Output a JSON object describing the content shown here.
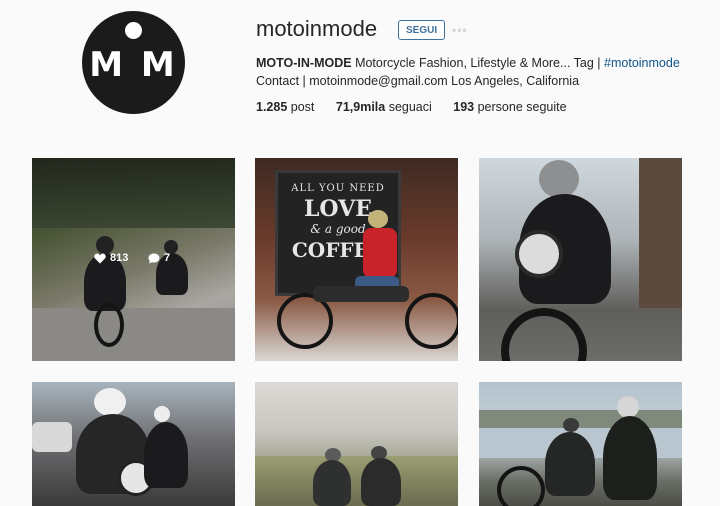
{
  "profile": {
    "username": "motoinmode",
    "follow_label": "SEGUI",
    "more_label": "◦◦◦",
    "avatar_text": "M M",
    "bio": {
      "name": "MOTO-IN-MODE",
      "text": " Motorcycle Fashion, Lifestyle & More... Tag | ",
      "hashtag": "#motoinmode",
      "line2": "Contact | motoinmode@gmail.com Los Angeles, California"
    },
    "stats": {
      "posts_value": "1.285",
      "posts_label": " post",
      "followers_value": "71,9mila",
      "followers_label": " seguaci",
      "following_value": "193",
      "following_label": " persone seguite"
    }
  },
  "grid": {
    "hover": {
      "likes": "813",
      "comments": "7"
    },
    "chalkboard": {
      "line1": "ALL YOU NEED",
      "line2": "LOVE",
      "line3": "& a good",
      "line4": "COFFEE"
    }
  },
  "colors": {
    "accent": "#3f729b",
    "link": "#125688",
    "text": "#262626",
    "background": "#fafafa"
  },
  "icons": [
    "heart-icon",
    "comment-icon",
    "more-icon"
  ]
}
